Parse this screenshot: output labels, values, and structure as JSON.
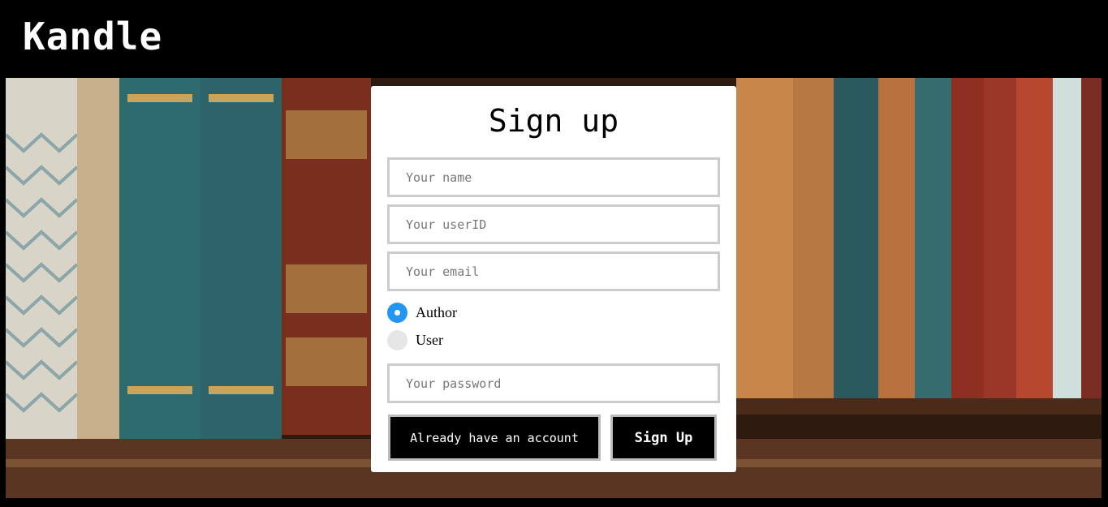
{
  "header": {
    "brand": "Kandle"
  },
  "form": {
    "title": "Sign up",
    "name_placeholder": "Your name",
    "userid_placeholder": "Your userID",
    "email_placeholder": "Your email",
    "role_options": [
      "Author",
      "User"
    ],
    "role_selected": "Author",
    "password_placeholder": "Your password",
    "login_label": "Already have an account",
    "signup_label": "Sign Up"
  },
  "colors": {
    "accent": "#2196F3",
    "button_bg": "#000000",
    "field_border": "#cccccc"
  },
  "icons": {
    "background": "bookshelf-image"
  }
}
